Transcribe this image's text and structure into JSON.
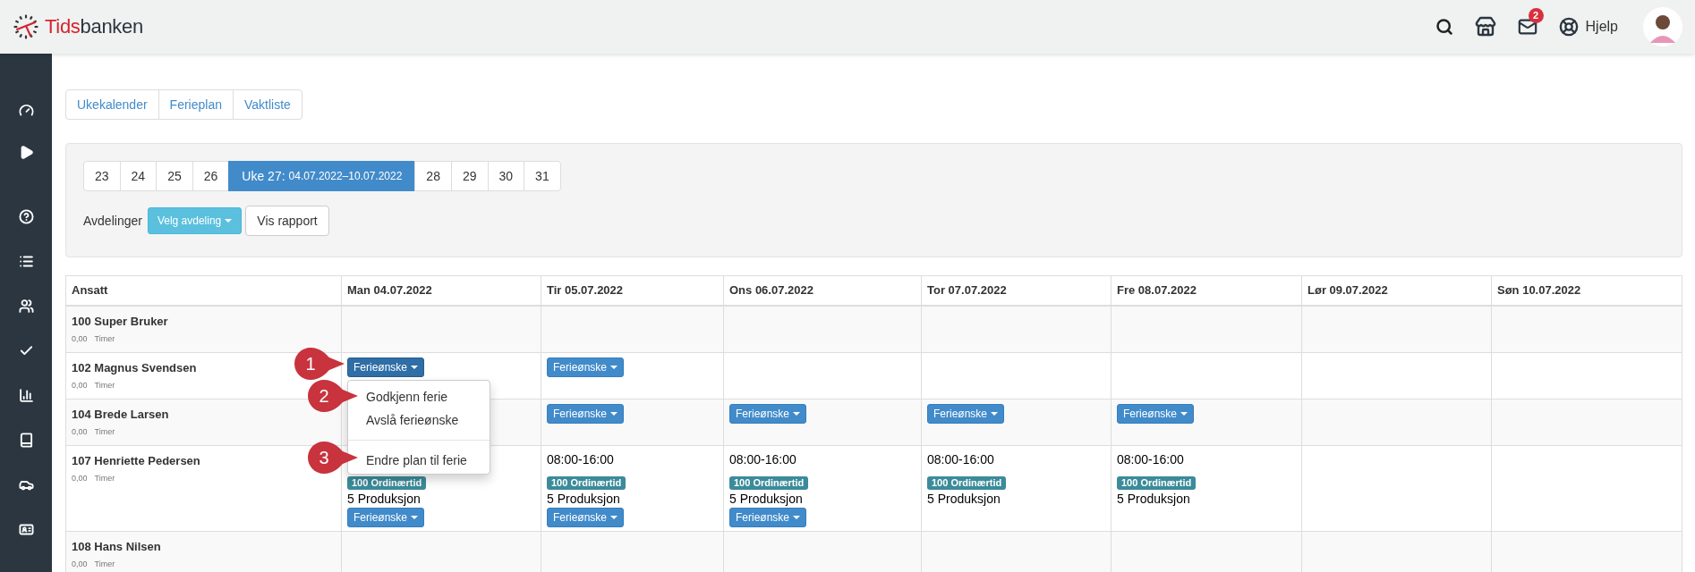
{
  "header": {
    "brand": {
      "lead": "Tids",
      "rest": "banken"
    },
    "mail_count": "2",
    "help_label": "Hjelp"
  },
  "view_tabs": [
    "Ukekalender",
    "Ferieplan",
    "Vaktliste"
  ],
  "filters": {
    "weeks": [
      {
        "label": "23",
        "selected": false
      },
      {
        "label": "24",
        "selected": false
      },
      {
        "label": "25",
        "selected": false
      },
      {
        "label": "26",
        "selected": false
      },
      {
        "label": "Uke 27:",
        "range": "04.07.2022–10.07.2022",
        "selected": true
      },
      {
        "label": "28",
        "selected": false
      },
      {
        "label": "29",
        "selected": false
      },
      {
        "label": "30",
        "selected": false
      },
      {
        "label": "31",
        "selected": false
      }
    ],
    "department_label": "Avdelinger",
    "department_button": "Velg avdeling",
    "report_button": "Vis rapport"
  },
  "table": {
    "employee_column": "Ansatt",
    "columns": [
      "Man 04.07.2022",
      "Tir 05.07.2022",
      "Ons 06.07.2022",
      "Tor 07.07.2022",
      "Fre 08.07.2022",
      "Lør 09.07.2022",
      "Søn 10.07.2022"
    ],
    "rows": [
      {
        "name": "100 Super Bruker",
        "hours": "0,00",
        "unit": "Timer",
        "cells": [
          {},
          {},
          {},
          {},
          {},
          {},
          {}
        ]
      },
      {
        "name": "102 Magnus Svendsen",
        "hours": "0,00",
        "unit": "Timer",
        "cells": [
          {
            "request": {
              "label": "Ferieønske",
              "open": true
            }
          },
          {
            "request": {
              "label": "Ferieønske",
              "open": false
            }
          },
          {},
          {},
          {},
          {},
          {}
        ]
      },
      {
        "name": "104 Brede Larsen",
        "hours": "0,00",
        "unit": "Timer",
        "cells": [
          {},
          {
            "request": {
              "label": "Ferieønske",
              "open": false
            }
          },
          {
            "request": {
              "label": "Ferieønske",
              "open": false
            }
          },
          {
            "request": {
              "label": "Ferieønske",
              "open": false
            }
          },
          {
            "request": {
              "label": "Ferieønske",
              "open": false
            }
          },
          {},
          {}
        ]
      },
      {
        "name": "107 Henriette Pedersen",
        "hours": "0,00",
        "unit": "Timer",
        "cells": [
          {
            "badge": "100 Ordinærtid",
            "activity": "5 Produksjon",
            "request": {
              "label": "Ferieønske",
              "open": false
            }
          },
          {
            "time": "08:00-16:00",
            "badge": "100 Ordinærtid",
            "activity": "5 Produksjon",
            "request": {
              "label": "Ferieønske",
              "open": false
            }
          },
          {
            "time": "08:00-16:00",
            "badge": "100 Ordinærtid",
            "activity": "5 Produksjon",
            "request": {
              "label": "Ferieønske",
              "open": false
            }
          },
          {
            "time": "08:00-16:00",
            "badge": "100 Ordinærtid",
            "activity": "5 Produksjon"
          },
          {
            "time": "08:00-16:00",
            "badge": "100 Ordinærtid",
            "activity": "5 Produksjon"
          },
          {},
          {}
        ]
      },
      {
        "name": "108 Hans Nilsen",
        "hours": "0,00",
        "unit": "Timer",
        "cells": [
          {},
          {},
          {},
          {},
          {},
          {},
          {}
        ]
      }
    ]
  },
  "context_menu": {
    "items": [
      {
        "kind": "item",
        "label": "Godkjenn ferie"
      },
      {
        "kind": "item",
        "label": "Avslå ferieønske"
      },
      {
        "kind": "divider"
      },
      {
        "kind": "item",
        "label": "Endre plan til ferie"
      }
    ]
  },
  "callouts": [
    "1",
    "2",
    "3"
  ]
}
